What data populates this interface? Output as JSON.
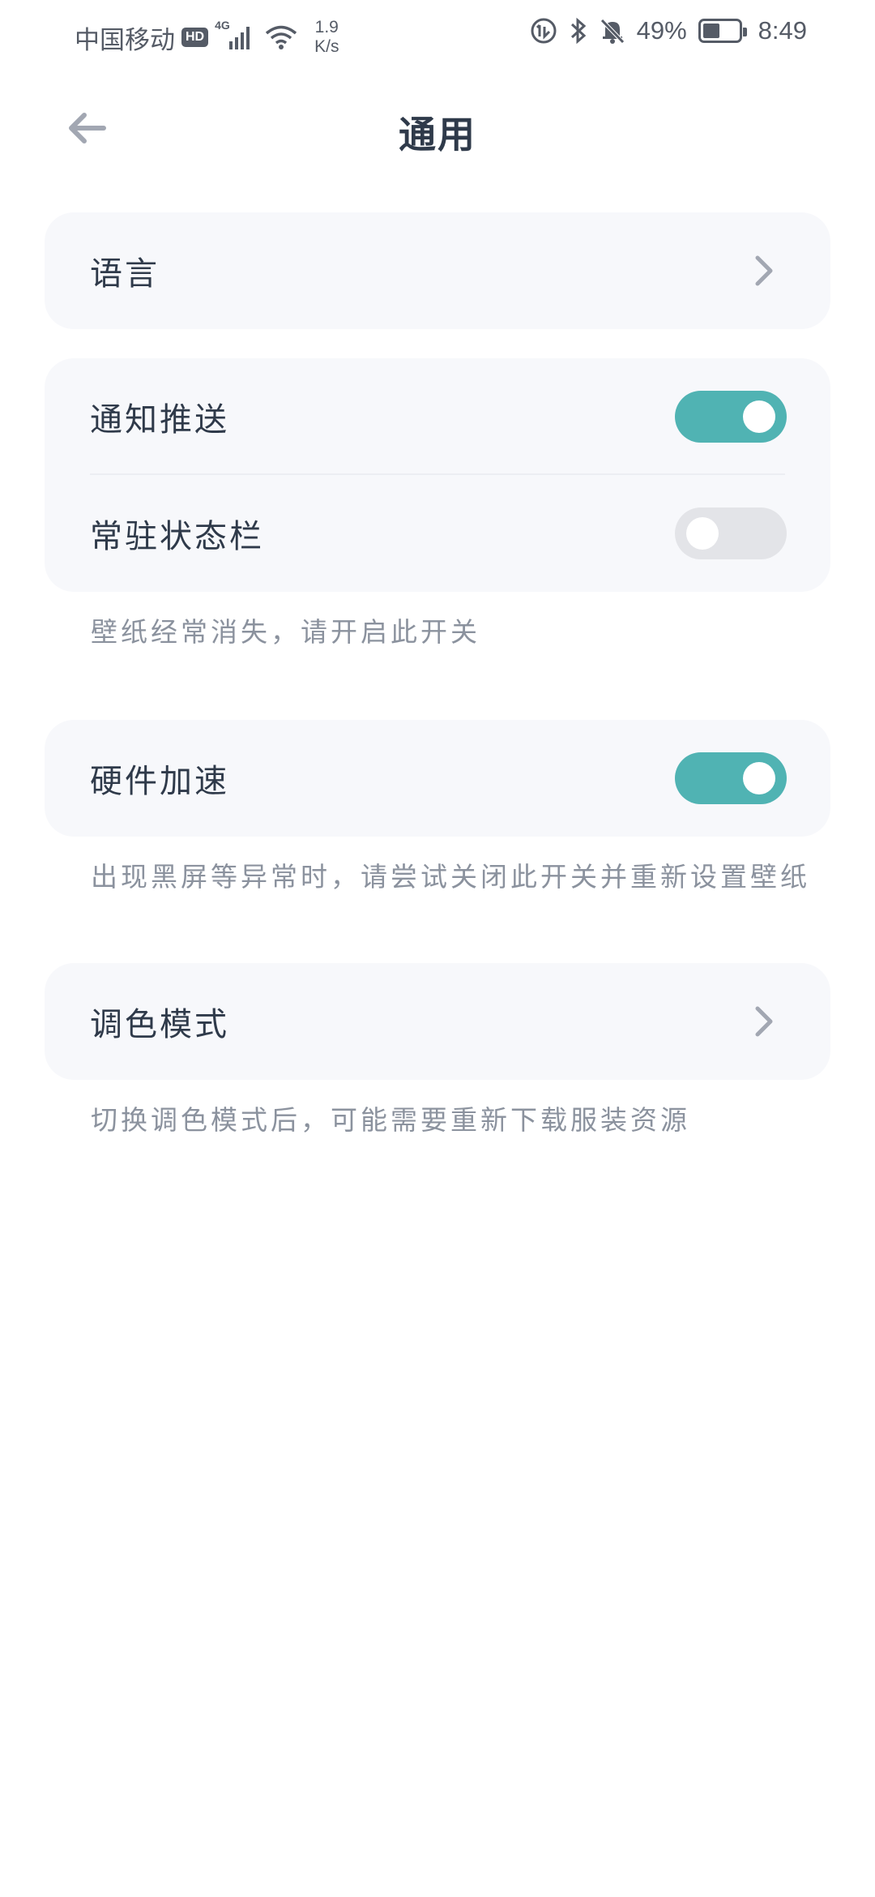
{
  "status_bar": {
    "carrier": "中国移动",
    "hd": "HD",
    "network": "4G",
    "speed_value": "1.9",
    "speed_unit": "K/s",
    "battery_percent": "49%",
    "battery_level": 0.49,
    "time": "8:49"
  },
  "header": {
    "title": "通用",
    "back_icon": "arrow-left-icon"
  },
  "sections": {
    "language": {
      "label": "语言"
    },
    "notifications": {
      "label": "通知推送",
      "enabled": true
    },
    "persistent_status": {
      "label": "常驻状态栏",
      "enabled": false
    },
    "persistent_hint": "壁纸经常消失，请开启此开关",
    "hardware_accel": {
      "label": "硬件加速",
      "enabled": true
    },
    "hardware_hint": "出现黑屏等异常时，请尝试关闭此开关并重新设置壁纸",
    "color_mode": {
      "label": "调色模式"
    },
    "color_hint": "切换调色模式后，可能需要重新下载服装资源"
  },
  "colors": {
    "accent": "#50b3b3",
    "toggle_off": "#e3e4e8",
    "card_bg": "#f7f8fb",
    "text_primary": "#2f3a4a",
    "text_hint": "#8b929e"
  }
}
